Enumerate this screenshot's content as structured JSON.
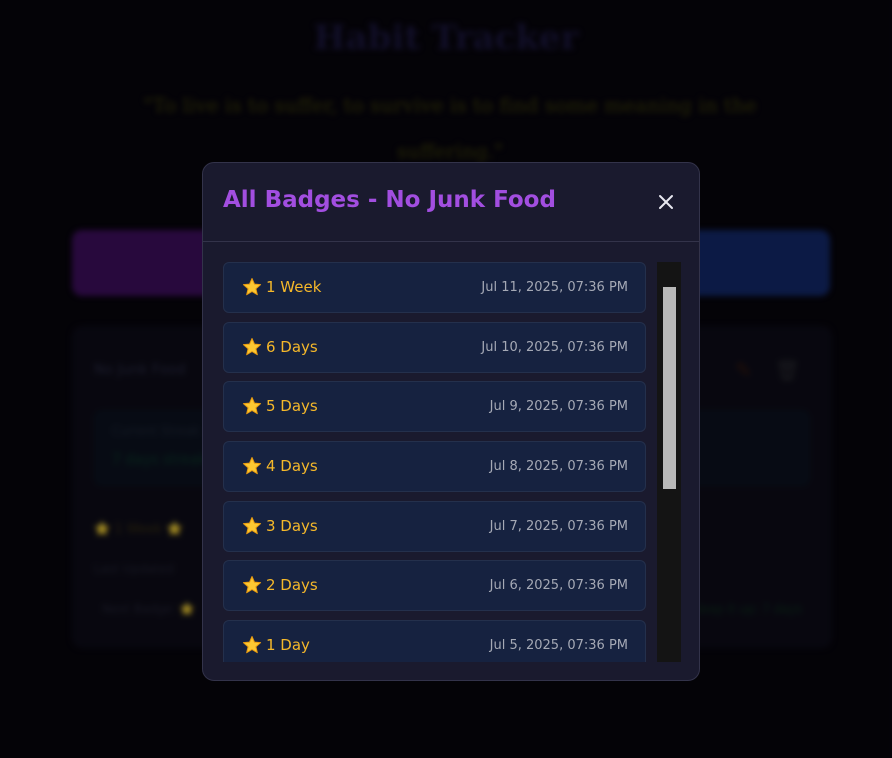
{
  "background": {
    "title": "Habit Tracker",
    "quote": "\"To live is to suffer, to survive is to find some meaning in the suffering.\"",
    "card": {
      "title": "No Junk Food",
      "inner_label": "Current Streak",
      "inner_value": "7 days streak",
      "badges_preview": "⭐ 1 Week   ⭐",
      "small_text_1": "Last Updated",
      "small_text_2": "Next Badge: ⭐",
      "small_text_3": "Keep it up: 7 days"
    }
  },
  "modal": {
    "title": "All Badges - No Junk Food",
    "close_icon": "close-icon",
    "accent_color": "#a24ee0",
    "star_color": "#f5b82a",
    "badges": [
      {
        "name": "1 Week",
        "date": "Jul 11, 2025, 07:36 PM"
      },
      {
        "name": "6 Days",
        "date": "Jul 10, 2025, 07:36 PM"
      },
      {
        "name": "5 Days",
        "date": "Jul 9, 2025, 07:36 PM"
      },
      {
        "name": "4 Days",
        "date": "Jul 8, 2025, 07:36 PM"
      },
      {
        "name": "3 Days",
        "date": "Jul 7, 2025, 07:36 PM"
      },
      {
        "name": "2 Days",
        "date": "Jul 6, 2025, 07:36 PM"
      },
      {
        "name": "1 Day",
        "date": "Jul 5, 2025, 07:36 PM"
      }
    ]
  }
}
